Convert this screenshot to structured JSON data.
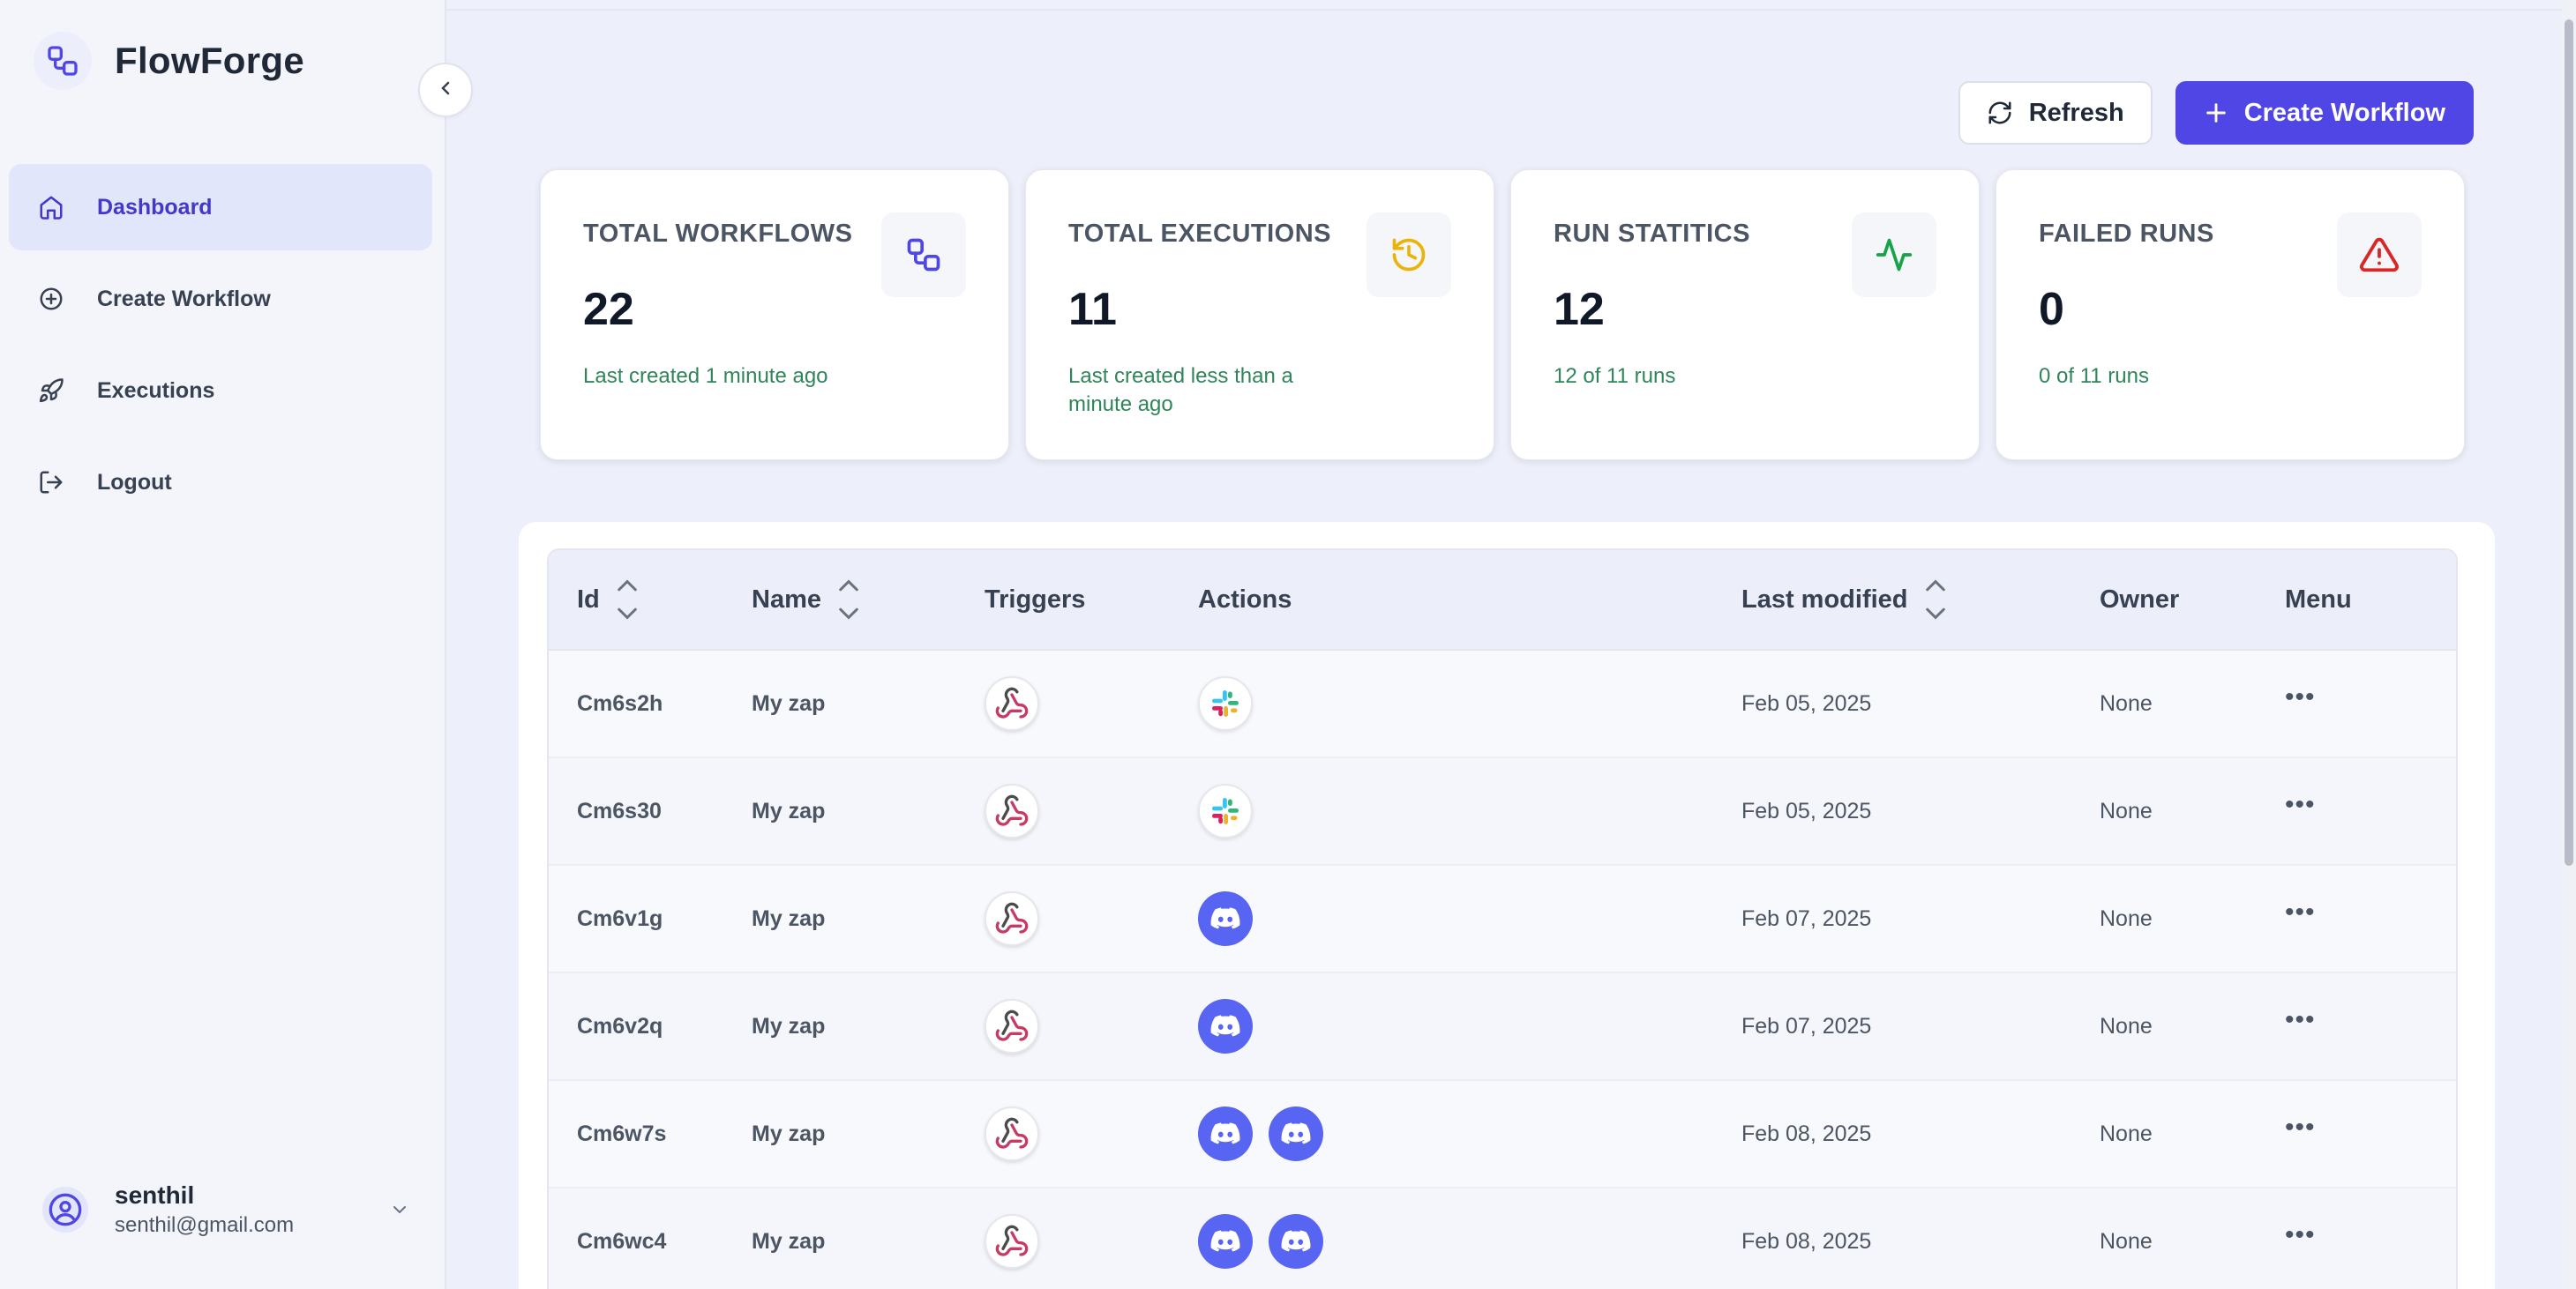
{
  "brand": {
    "name": "FlowForge"
  },
  "sidebar": {
    "items": [
      {
        "label": "Dashboard",
        "icon": "home-icon",
        "active": true
      },
      {
        "label": "Create Workflow",
        "icon": "plus-circle-icon"
      },
      {
        "label": "Executions",
        "icon": "rocket-icon"
      },
      {
        "label": "Logout",
        "icon": "logout-icon"
      }
    ],
    "user": {
      "name": "senthil",
      "email": "senthil@gmail.com"
    }
  },
  "toolbar": {
    "refresh_label": "Refresh",
    "create_label": "Create Workflow"
  },
  "stats": [
    {
      "title": "TOTAL WORKFLOWS",
      "value": "22",
      "sub": "Last created 1 minute ago",
      "icon": "workflow-icon",
      "icon_color": "#4f46e5"
    },
    {
      "title": "TOTAL EXECUTIONS",
      "value": "11",
      "sub": "Last created less than a minute ago",
      "icon": "history-icon",
      "icon_color": "#eab308"
    },
    {
      "title": "RUN STATITICS",
      "value": "12",
      "sub": "12 of 11 runs",
      "icon": "activity-icon",
      "icon_color": "#16a34a"
    },
    {
      "title": "FAILED RUNS",
      "value": "0",
      "sub": "0 of 11 runs",
      "icon": "alert-triangle-icon",
      "icon_color": "#dc2626"
    }
  ],
  "table": {
    "headers": {
      "id": "Id",
      "name": "Name",
      "triggers": "Triggers",
      "actions": "Actions",
      "last_modified": "Last modified",
      "owner": "Owner",
      "menu": "Menu"
    },
    "rows": [
      {
        "id": "Cm6s2h",
        "name": "My zap",
        "trigger": "webhook",
        "actions": [
          "slack"
        ],
        "modified": "Feb 05, 2025",
        "owner": "None"
      },
      {
        "id": "Cm6s30",
        "name": "My zap",
        "trigger": "webhook",
        "actions": [
          "slack"
        ],
        "modified": "Feb 05, 2025",
        "owner": "None"
      },
      {
        "id": "Cm6v1g",
        "name": "My zap",
        "trigger": "webhook",
        "actions": [
          "discord"
        ],
        "modified": "Feb 07, 2025",
        "owner": "None"
      },
      {
        "id": "Cm6v2q",
        "name": "My zap",
        "trigger": "webhook",
        "actions": [
          "discord"
        ],
        "modified": "Feb 07, 2025",
        "owner": "None"
      },
      {
        "id": "Cm6w7s",
        "name": "My zap",
        "trigger": "webhook",
        "actions": [
          "discord",
          "discord"
        ],
        "modified": "Feb 08, 2025",
        "owner": "None"
      },
      {
        "id": "Cm6wc4",
        "name": "My zap",
        "trigger": "webhook",
        "actions": [
          "discord",
          "discord"
        ],
        "modified": "Feb 08, 2025",
        "owner": "None"
      }
    ]
  },
  "colors": {
    "primary": "#4f46e5",
    "success_text": "#2f855a",
    "discord": "#5865f2"
  }
}
